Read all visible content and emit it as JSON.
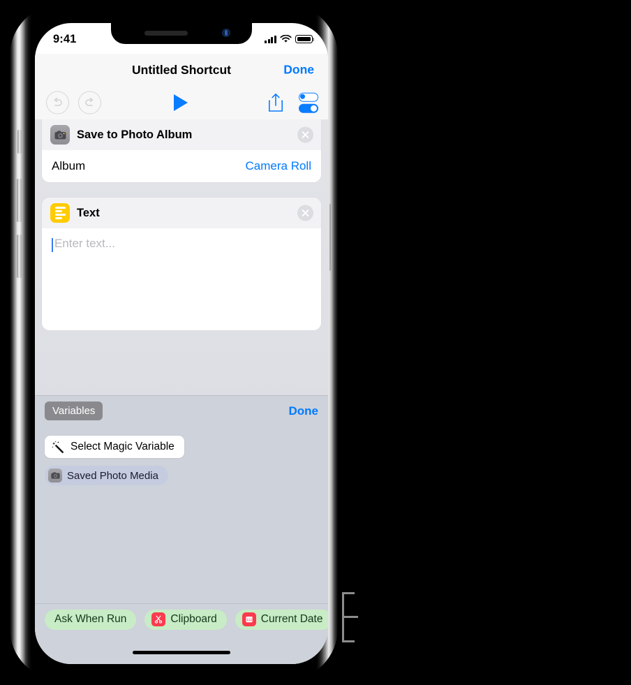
{
  "status_bar": {
    "time": "9:41",
    "signal_icon": "cellular-signal-icon",
    "wifi_icon": "wifi-icon",
    "battery_icon": "battery-icon"
  },
  "nav_bar": {
    "title": "Untitled Shortcut",
    "done_label": "Done"
  },
  "toolbar": {
    "undo_icon": "undo-icon",
    "redo_icon": "redo-icon",
    "play_icon": "play-icon",
    "share_icon": "share-icon",
    "settings_icon": "settings-toggles-icon",
    "accent_color": "#007aff"
  },
  "actions": [
    {
      "icon": "camera-icon",
      "icon_color": "#8e8e94",
      "title": "Save to Photo Album",
      "close_icon": "close-circle-icon",
      "rows": [
        {
          "label": "Album",
          "value": "Camera Roll"
        }
      ]
    },
    {
      "icon": "text-lines-icon",
      "icon_color": "#ffcc00",
      "title": "Text",
      "close_icon": "close-circle-icon",
      "field": {
        "value": "",
        "placeholder": "Enter text..."
      }
    }
  ],
  "variables_bar": {
    "variables_label": "Variables",
    "done_label": "Done"
  },
  "variables_panel": {
    "magic_variable": {
      "icon": "magic-wand-icon",
      "label": "Select Magic Variable"
    },
    "tokens": [
      {
        "icon": "camera-icon",
        "label": "Saved Photo Media"
      }
    ]
  },
  "chips": [
    {
      "label": "Ask When Run",
      "icon": null,
      "icon_color": null
    },
    {
      "label": "Clipboard",
      "icon": "scissors-icon",
      "icon_color": "#fb3b4e"
    },
    {
      "label": "Current Date",
      "icon": "calendar-icon",
      "icon_color": "#fb3b4e"
    }
  ],
  "home_indicator": "home-indicator",
  "callout": "callout-bracket"
}
